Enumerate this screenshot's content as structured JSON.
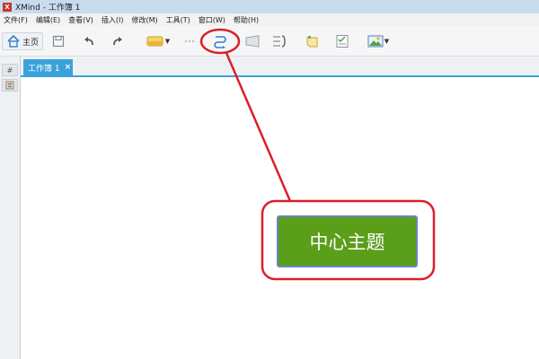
{
  "window": {
    "title": "XMind - 工作簿 1",
    "logo": "X"
  },
  "menubar": {
    "items": [
      "文件(F)",
      "编辑(E)",
      "查看(V)",
      "插入(I)",
      "修改(M)",
      "工具(T)",
      "窗口(W)",
      "帮助(H)"
    ]
  },
  "toolbar": {
    "home_label": "主页",
    "icons": [
      "home-icon",
      "save-icon",
      "undo-icon",
      "redo-icon",
      "topic-icon",
      "more-icon",
      "relationship-icon",
      "boundary-icon",
      "summary-icon",
      "note-icon",
      "task-icon",
      "image-icon"
    ]
  },
  "sidepanel": {
    "tab_label": "#"
  },
  "tabs": {
    "active_label": "工作簿 1",
    "close_label": "×"
  },
  "canvas": {
    "central_topic": "中心主题"
  },
  "colors": {
    "accent_blue": "#3aa2db",
    "topic_green": "#5a9e1a",
    "annotation_red": "#d9202a"
  }
}
